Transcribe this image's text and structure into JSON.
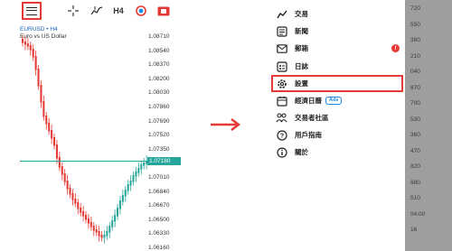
{
  "left_screen": {
    "toolbar": {
      "menu_icon": "hamburger-menu-icon",
      "crosshair_icon": "crosshair-icon",
      "indicator_icon": "indicator-icon",
      "timeframe_label": "H4",
      "objects_icon": "objects-icon",
      "trade_icon": "trade-icon"
    },
    "chart": {
      "symbol_line": "EURUSD • H4",
      "description": "Euro vs US Dollar",
      "price_labels": [
        "1.08710",
        "1.08540",
        "1.08370",
        "1.08200",
        "1.08030",
        "1.07860",
        "1.07690",
        "1.07520",
        "1.07350",
        "1.07180",
        "1.07010",
        "1.06840",
        "1.06670",
        "1.06500",
        "1.06330",
        "1.06160"
      ],
      "bid_label": "1.07180",
      "bull_color": "#26a69a",
      "bear_color": "#e53935"
    }
  },
  "arrow_color": "#e53935",
  "right_screen": {
    "menu_items": [
      {
        "label": "交易",
        "icon": "trade-chart-icon"
      },
      {
        "label": "新聞",
        "icon": "news-icon"
      },
      {
        "label": "郵箱",
        "icon": "mailbox-icon",
        "badge": "!"
      },
      {
        "label": "日誌",
        "icon": "journal-icon"
      },
      {
        "label": "設置",
        "icon": "settings-gear-icon",
        "highlighted": true
      },
      {
        "label": "經濟日曆",
        "icon": "calendar-icon",
        "tag": "Ads"
      },
      {
        "label": "交易者社區",
        "icon": "community-icon"
      },
      {
        "label": "用戶指南",
        "icon": "help-icon"
      },
      {
        "label": "關於",
        "icon": "info-icon"
      }
    ],
    "backdrop_labels": [
      "720",
      "550",
      "380",
      "210",
      "040",
      "870",
      "700",
      "530",
      "360",
      "470",
      "820",
      "680",
      "510",
      "04:00",
      "16"
    ],
    "highlight_color": "#e53935"
  }
}
